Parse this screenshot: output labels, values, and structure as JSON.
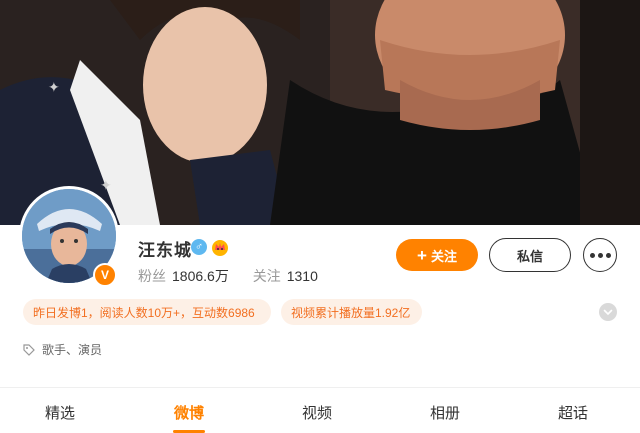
{
  "profile": {
    "name": "汪东城",
    "followers_label": "粉丝",
    "followers_value": "1806.6万",
    "following_label": "关注",
    "following_value": "1310",
    "verified_badge": "V",
    "gender_symbol": "♂"
  },
  "actions": {
    "follow_plus": "+",
    "follow_label": "关注",
    "message_label": "私信"
  },
  "highlights": {
    "yesterday": "昨日发博1，阅读人数10万+，互动数6986",
    "video_plays": "视频累计播放量1.92亿"
  },
  "tags": "歌手、演员",
  "tabs": [
    {
      "label": "精选"
    },
    {
      "label": "微博"
    },
    {
      "label": "视频"
    },
    {
      "label": "相册"
    },
    {
      "label": "超话"
    }
  ],
  "active_tab_index": 1,
  "colors": {
    "accent": "#ff8200",
    "pill_bg": "#fdf0e6",
    "pill_text": "#f26f21",
    "gender_blue": "#5eb8f0"
  },
  "icons": [
    "gender-male-icon",
    "crown-icon",
    "verified-badge-icon",
    "more-dots-icon",
    "chevron-down-icon",
    "tag-icon"
  ]
}
